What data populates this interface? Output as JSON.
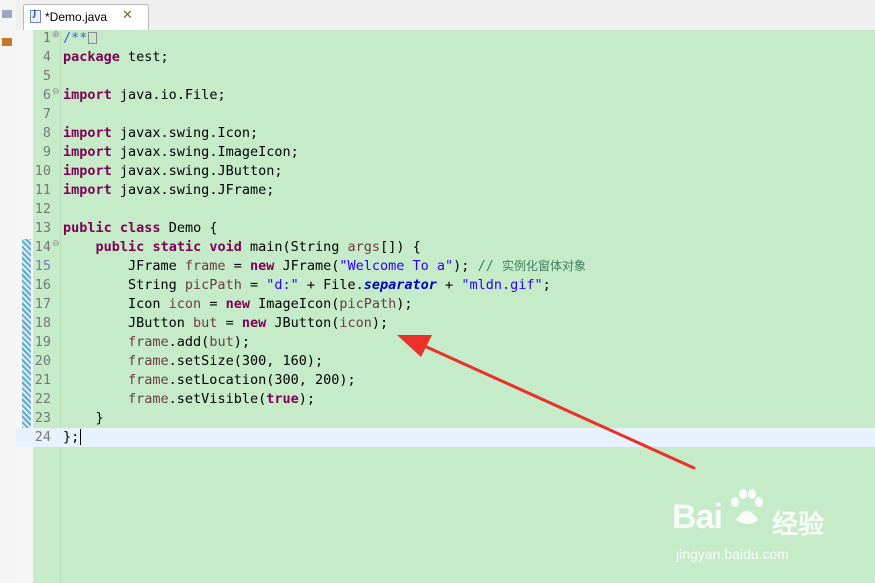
{
  "tab": {
    "label": "*Demo.java",
    "icon": "java-file-icon",
    "close_icon": "close-icon"
  },
  "lines": [
    {
      "no": "1",
      "fold": "plus",
      "segs": [
        {
          "c": "jd",
          "t": "/**"
        }
      ],
      "collapsed": true
    },
    {
      "no": "4",
      "segs": [
        {
          "c": "kw",
          "t": "package"
        },
        {
          "c": "",
          "t": " test;"
        }
      ]
    },
    {
      "no": "5",
      "segs": []
    },
    {
      "no": "6",
      "fold": "minus",
      "segs": [
        {
          "c": "kw",
          "t": "import"
        },
        {
          "c": "",
          "t": " java.io.File;"
        }
      ]
    },
    {
      "no": "7",
      "segs": []
    },
    {
      "no": "8",
      "segs": [
        {
          "c": "kw",
          "t": "import"
        },
        {
          "c": "",
          "t": " javax.swing.Icon;"
        }
      ]
    },
    {
      "no": "9",
      "segs": [
        {
          "c": "kw",
          "t": "import"
        },
        {
          "c": "",
          "t": " javax.swing.ImageIcon;"
        }
      ]
    },
    {
      "no": "10",
      "segs": [
        {
          "c": "kw",
          "t": "import"
        },
        {
          "c": "",
          "t": " javax.swing.JButton;"
        }
      ]
    },
    {
      "no": "11",
      "segs": [
        {
          "c": "kw",
          "t": "import"
        },
        {
          "c": "",
          "t": " javax.swing.JFrame;"
        }
      ]
    },
    {
      "no": "12",
      "segs": []
    },
    {
      "no": "13",
      "segs": [
        {
          "c": "kw",
          "t": "public"
        },
        {
          "c": "",
          "t": " "
        },
        {
          "c": "kw",
          "t": "class"
        },
        {
          "c": "",
          "t": " Demo {"
        }
      ]
    },
    {
      "no": "14",
      "fold": "minus",
      "segs": [
        {
          "c": "",
          "t": "    "
        },
        {
          "c": "kw",
          "t": "public"
        },
        {
          "c": "",
          "t": " "
        },
        {
          "c": "kw",
          "t": "static"
        },
        {
          "c": "",
          "t": " "
        },
        {
          "c": "kw",
          "t": "void"
        },
        {
          "c": "",
          "t": " main(String "
        },
        {
          "c": "var",
          "t": "args"
        },
        {
          "c": "",
          "t": "[]) {"
        }
      ]
    },
    {
      "no": "15",
      "hl": true,
      "segs": [
        {
          "c": "",
          "t": "        JFrame "
        },
        {
          "c": "var",
          "t": "frame"
        },
        {
          "c": "",
          "t": " = "
        },
        {
          "c": "kw",
          "t": "new"
        },
        {
          "c": "",
          "t": " JFrame("
        },
        {
          "c": "str",
          "t": "\"Welcome To a\""
        },
        {
          "c": "",
          "t": "); "
        },
        {
          "c": "cmt",
          "t": "// "
        },
        {
          "c": "cmt cn",
          "t": "实例化窗体对象"
        }
      ]
    },
    {
      "no": "16",
      "segs": [
        {
          "c": "",
          "t": "        String "
        },
        {
          "c": "var",
          "t": "picPath"
        },
        {
          "c": "",
          "t": " = "
        },
        {
          "c": "str",
          "t": "\"d:\""
        },
        {
          "c": "",
          "t": " + File."
        },
        {
          "c": "sfld",
          "t": "separator"
        },
        {
          "c": "",
          "t": " + "
        },
        {
          "c": "str",
          "t": "\"mldn.gif\""
        },
        {
          "c": "",
          "t": ";"
        }
      ]
    },
    {
      "no": "17",
      "segs": [
        {
          "c": "",
          "t": "        Icon "
        },
        {
          "c": "var",
          "t": "icon"
        },
        {
          "c": "",
          "t": " = "
        },
        {
          "c": "kw",
          "t": "new"
        },
        {
          "c": "",
          "t": " ImageIcon("
        },
        {
          "c": "var",
          "t": "picPath"
        },
        {
          "c": "",
          "t": ");"
        }
      ]
    },
    {
      "no": "18",
      "segs": [
        {
          "c": "",
          "t": "        JButton "
        },
        {
          "c": "var",
          "t": "but"
        },
        {
          "c": "",
          "t": " = "
        },
        {
          "c": "kw",
          "t": "new"
        },
        {
          "c": "",
          "t": " JButton("
        },
        {
          "c": "var",
          "t": "icon"
        },
        {
          "c": "",
          "t": ");"
        }
      ]
    },
    {
      "no": "19",
      "segs": [
        {
          "c": "",
          "t": "        "
        },
        {
          "c": "var",
          "t": "frame"
        },
        {
          "c": "",
          "t": ".add("
        },
        {
          "c": "var",
          "t": "but"
        },
        {
          "c": "",
          "t": ");"
        }
      ]
    },
    {
      "no": "20",
      "segs": [
        {
          "c": "",
          "t": "        "
        },
        {
          "c": "var",
          "t": "frame"
        },
        {
          "c": "",
          "t": ".setSize(300, 160);"
        }
      ]
    },
    {
      "no": "21",
      "segs": [
        {
          "c": "",
          "t": "        "
        },
        {
          "c": "var",
          "t": "frame"
        },
        {
          "c": "",
          "t": ".setLocation(300, 200);"
        }
      ]
    },
    {
      "no": "22",
      "segs": [
        {
          "c": "",
          "t": "        "
        },
        {
          "c": "var",
          "t": "frame"
        },
        {
          "c": "",
          "t": ".setVisible("
        },
        {
          "c": "kw",
          "t": "true"
        },
        {
          "c": "",
          "t": ");"
        }
      ]
    },
    {
      "no": "23",
      "segs": [
        {
          "c": "",
          "t": "    }"
        }
      ]
    },
    {
      "no": "24",
      "current": true,
      "cursor": true,
      "segs": [
        {
          "c": "",
          "t": "};"
        }
      ]
    }
  ],
  "watermark": {
    "logo": "Bai",
    "brand_cn": "经验",
    "url": "jingyan.baidu.com"
  },
  "colors": {
    "editor_bg": "#c5ebc9",
    "current_line": "#e8f2fe",
    "keyword": "#7f0055",
    "string": "#2a00ff",
    "local_var": "#6a3e3e",
    "comment": "#3f7f5f",
    "arrow": "#e8312a"
  }
}
